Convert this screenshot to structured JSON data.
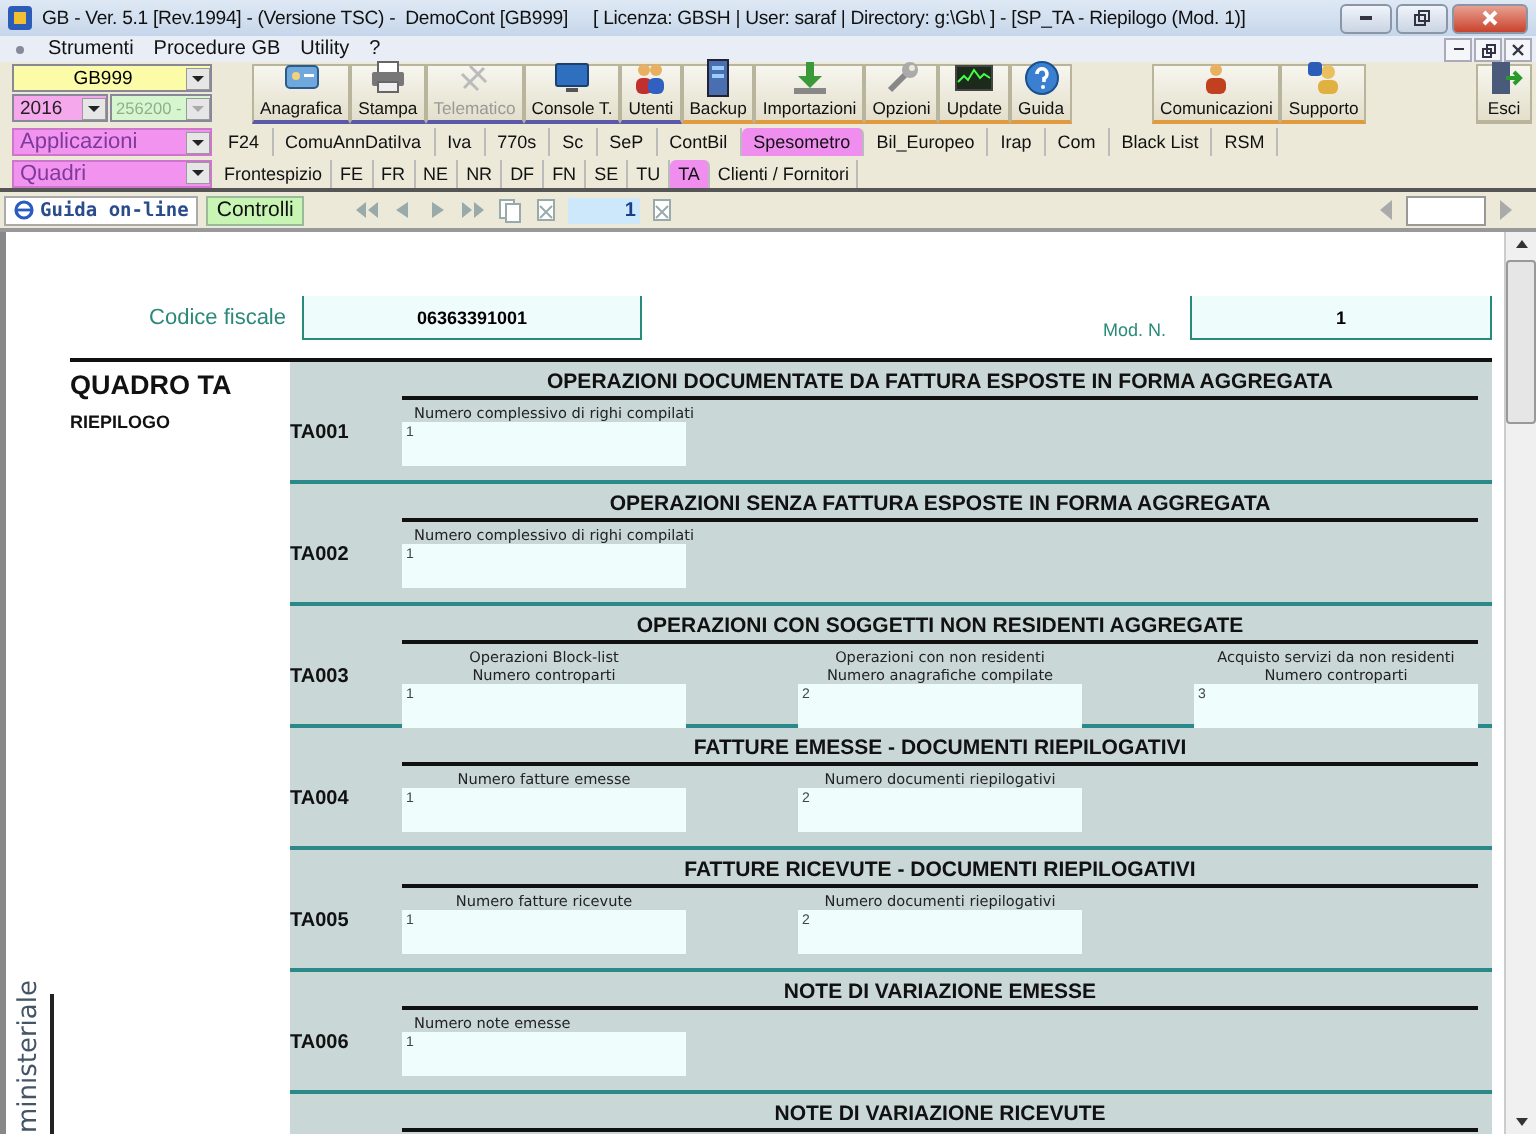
{
  "window": {
    "title": "GB - Ver. 5.1 [Rev.1994] - (Versione TSC) -  DemoCont [GB999]     [ Licenza: GBSH | User: saraf | Directory: g:\\Gb\\ ] - [SP_TA - Riepilogo (Mod. 1)]"
  },
  "menu": [
    "Strumenti",
    "Procedure GB",
    "Utility",
    "?"
  ],
  "selectors": [
    {
      "value": "GB999",
      "disabled": false
    },
    {
      "value": "2016",
      "disabled": false
    },
    {
      "value": "256200 -",
      "disabled": true
    }
  ],
  "toolbar": [
    {
      "label": "Anagrafica",
      "disabled": false,
      "kind": "main"
    },
    {
      "label": "Stampa",
      "disabled": false,
      "kind": "main"
    },
    {
      "label": "Telematico",
      "disabled": true,
      "kind": "main"
    },
    {
      "label": "Console T.",
      "disabled": false,
      "kind": "main"
    },
    {
      "label": "Utenti",
      "disabled": false,
      "kind": "main"
    },
    {
      "label": "Backup",
      "disabled": false,
      "kind": "tools"
    },
    {
      "label": "Importazioni",
      "disabled": false,
      "kind": "tools"
    },
    {
      "label": "Opzioni",
      "disabled": false,
      "kind": "tools"
    },
    {
      "label": "Update",
      "disabled": false,
      "kind": "tools"
    },
    {
      "label": "Guida",
      "disabled": false,
      "kind": "tools"
    },
    {
      "label": "Comunicazioni",
      "disabled": false,
      "kind": "support"
    },
    {
      "label": "Supporto",
      "disabled": false,
      "kind": "support"
    },
    {
      "label": "Esci",
      "disabled": false,
      "kind": "exit"
    }
  ],
  "applications": {
    "value": "Applicazioni",
    "tabs": [
      {
        "label": "F24",
        "selected": false
      },
      {
        "label": "ComuAnnDatiIva",
        "selected": false
      },
      {
        "label": "Iva",
        "selected": false
      },
      {
        "label": "770s",
        "selected": false
      },
      {
        "label": "Sc",
        "selected": false
      },
      {
        "label": "SeP",
        "selected": false
      },
      {
        "label": "ContBil",
        "selected": false
      },
      {
        "label": "Spesometro",
        "selected": true
      },
      {
        "label": "Bil_Europeo",
        "selected": false
      },
      {
        "label": "Irap",
        "selected": false
      },
      {
        "label": "Com",
        "selected": false
      },
      {
        "label": "Black List",
        "selected": false
      },
      {
        "label": "RSM",
        "selected": false
      }
    ]
  },
  "quadri": {
    "value": "Quadri",
    "tabs": [
      {
        "label": "Frontespizio",
        "selected": false
      },
      {
        "label": "FE",
        "selected": false
      },
      {
        "label": "FR",
        "selected": false
      },
      {
        "label": "NE",
        "selected": false
      },
      {
        "label": "NR",
        "selected": false
      },
      {
        "label": "DF",
        "selected": false
      },
      {
        "label": "FN",
        "selected": false
      },
      {
        "label": "SE",
        "selected": false
      },
      {
        "label": "TU",
        "selected": false
      },
      {
        "label": "TA",
        "selected": true
      },
      {
        "label": "Clienti / Fornitori",
        "selected": false
      }
    ]
  },
  "nav": {
    "help_button": "Guida on-line",
    "controls_button": "Controlli",
    "page": "1"
  },
  "form": {
    "tax_code_label": "Codice fiscale",
    "tax_code": "06363391001",
    "model_label": "Mod. N.",
    "model_number": "1",
    "quadro_title": "QUADRO TA",
    "quadro_subtitle": "RIEPILOGO",
    "side_note": "ministeriale",
    "sections": [
      {
        "code": "TA001",
        "title": "OPERAZIONI DOCUMENTATE DA FATTURA ESPOSTE IN FORMA AGGREGATA",
        "fields": [
          {
            "label_lines": [
              "Numero complessivo di righi compilati"
            ],
            "number": "1"
          }
        ]
      },
      {
        "code": "TA002",
        "title": "OPERAZIONI SENZA FATTURA ESPOSTE IN FORMA AGGREGATA",
        "fields": [
          {
            "label_lines": [
              "Numero complessivo di righi compilati"
            ],
            "number": "1"
          }
        ]
      },
      {
        "code": "TA003",
        "title": "OPERAZIONI CON SOGGETTI NON RESIDENTI AGGREGATE",
        "fields": [
          {
            "label_lines": [
              "Operazioni Block-list",
              "Numero controparti"
            ],
            "number": "1"
          },
          {
            "label_lines": [
              "Operazioni con non residenti",
              "Numero anagrafiche compilate"
            ],
            "number": "2"
          },
          {
            "label_lines": [
              "Acquisto servizi da non residenti",
              "Numero controparti"
            ],
            "number": "3"
          }
        ]
      },
      {
        "code": "TA004",
        "title": "FATTURE EMESSE - DOCUMENTI RIEPILOGATIVI",
        "fields": [
          {
            "label_lines": [
              "Numero fatture emesse"
            ],
            "number": "1"
          },
          {
            "label_lines": [
              "Numero documenti riepilogativi"
            ],
            "number": "2"
          }
        ]
      },
      {
        "code": "TA005",
        "title": "FATTURE RICEVUTE - DOCUMENTI RIEPILOGATIVI",
        "fields": [
          {
            "label_lines": [
              "Numero fatture ricevute"
            ],
            "number": "1"
          },
          {
            "label_lines": [
              "Numero documenti riepilogativi"
            ],
            "number": "2"
          }
        ]
      },
      {
        "code": "TA006",
        "title": "NOTE DI VARIAZIONE EMESSE",
        "fields": [
          {
            "label_lines": [
              "Numero note emesse"
            ],
            "number": "1"
          }
        ]
      },
      {
        "title": "NOTE DI VARIAZIONE RICEVUTE"
      }
    ]
  }
}
